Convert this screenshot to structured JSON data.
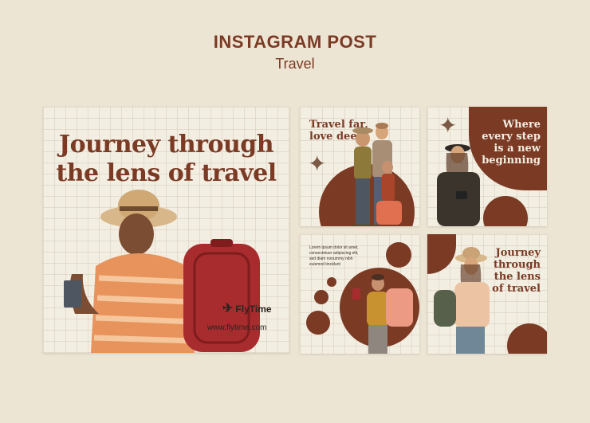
{
  "header": {
    "title": "INSTAGRAM POST",
    "subtitle": "Travel"
  },
  "big_card": {
    "headline_line1": "Journey through",
    "headline_line2": "the lens of travel",
    "brand": "FlyTime",
    "url": "www.flytime.com"
  },
  "card2": {
    "line1": "Travel far,",
    "line2": "love deep"
  },
  "card3": {
    "line1": "Where",
    "line2": "every step",
    "line3": "is a new",
    "line4": "beginning"
  },
  "card4": {
    "p1": "Lorem ipsum dolor sit amet,",
    "p2": "consectetuer adipiscing elit,",
    "p3": "sed diam nonummy nibh",
    "p4": "euismod tincidunt"
  },
  "card5": {
    "line1": "Journey",
    "line2": "through",
    "line3": "the lens",
    "line4": "of travel"
  },
  "colors": {
    "background": "#ede5d3",
    "brand_brown": "#7a3a24",
    "card_paper": "#f3eee2"
  },
  "icons": [
    "plane-icon",
    "compass-icon"
  ]
}
